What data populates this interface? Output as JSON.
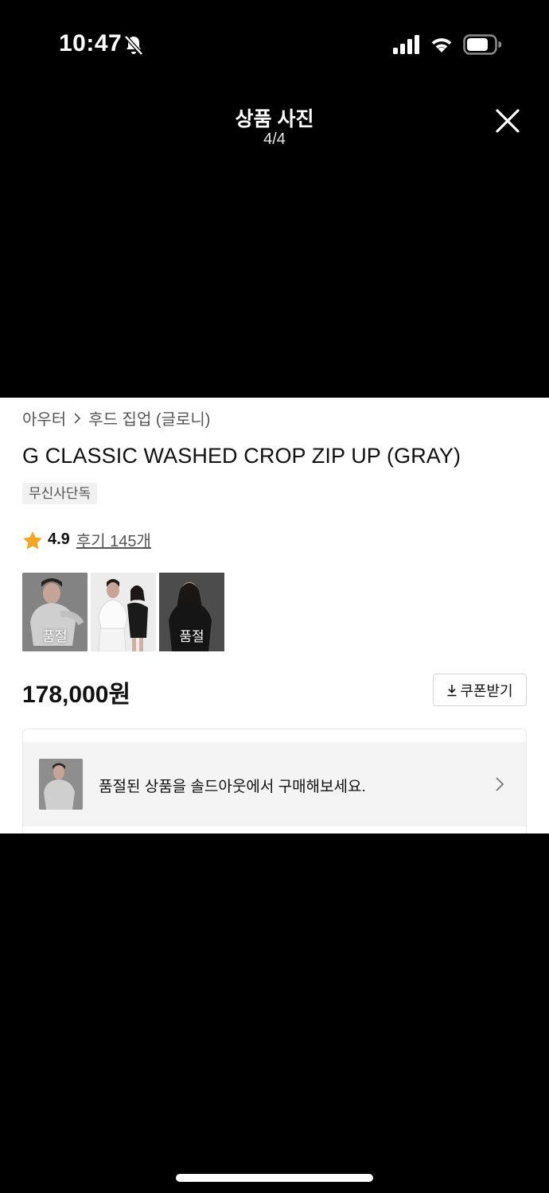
{
  "status_bar": {
    "time": "10:47",
    "icons": [
      "bell-slash-icon",
      "cellular-signal-icon",
      "wifi-icon",
      "battery-icon"
    ]
  },
  "viewer": {
    "title": "상품 사진",
    "counter_current": "4",
    "counter_separator": "/",
    "counter_total": "4",
    "close_icon": "close-icon"
  },
  "product": {
    "breadcrumb": [
      "아우터",
      "후드 집업 (글로니)"
    ],
    "name": "G CLASSIC WASHED CROP ZIP UP (GRAY)",
    "exclusive_badge": "무신사단독",
    "rating": "4.9",
    "review_link": "후기 145개",
    "thumbnails": [
      {
        "label": "품절",
        "selected": true,
        "tone": "gray"
      },
      {
        "label": "",
        "selected": false,
        "tone": "white"
      },
      {
        "label": "품절",
        "selected": false,
        "tone": "black"
      }
    ],
    "price": "178,000원",
    "coupon_button": "쿠폰받기",
    "soldout_banner": "품절된 상품을 솔드아웃에서 구매해보세요."
  },
  "colors": {
    "background": "#000000",
    "rating_star": "#f5a623",
    "text_primary": "#111111",
    "text_secondary": "#555555",
    "badge_bg": "#f1f1f1",
    "banner_bg": "#f4f4f4"
  }
}
